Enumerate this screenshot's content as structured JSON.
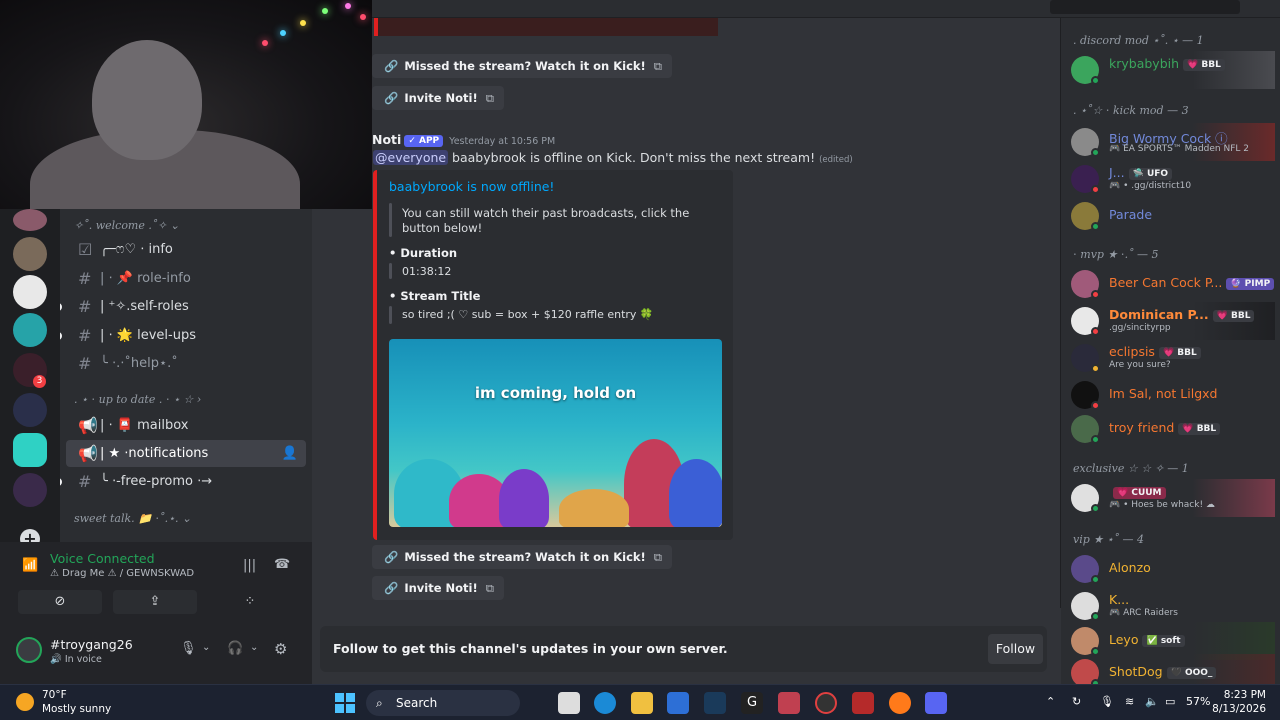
{
  "channels": {
    "categories": {
      "welcome": "✧˚. welcome .˚✧ ⌄",
      "up_to_date": ". ⋆ ⋅ up to date . ⋅ ⋆ ☆ ›",
      "sweet_talk": "sweet talk. 📁 ⋅˚.⋆. ⌄"
    },
    "items": [
      {
        "icon": "☑",
        "label": "╭─ෆ♡ ⋅ info"
      },
      {
        "icon": "#",
        "label": "| ⋅ 📌 role-info"
      },
      {
        "icon": "#",
        "label": "| ⁺✧.self-roles"
      },
      {
        "icon": "#",
        "label": "| ⋅ 🌟 level-ups"
      },
      {
        "icon": "#",
        "label": "╰ ⋅.⋅˚help⋆.˚"
      },
      {
        "icon": "📢",
        "label": "| ⋅ 📮 mailbox"
      },
      {
        "icon": "📢",
        "label": "| ★ ⋅notifications"
      },
      {
        "icon": "#",
        "label": "╰ ⋅-free-promo ⋅→"
      }
    ]
  },
  "voice": {
    "status": "Voice Connected",
    "location": "⚠ Drag Me ⚠ / GEWNSKWAD",
    "username": "#troygang26",
    "user_status": "🔊 In voice"
  },
  "chat": {
    "prev_link1": "Missed the stream? Watch it on Kick!",
    "prev_link2": "Invite Noti!",
    "author": "Noti",
    "app_tag": "✓ APP",
    "timestamp": "Yesterday at 10:56 PM",
    "mention": "@everyone",
    "message": " baabybrook is offline on Kick. Don't miss the next stream!",
    "edited": "(edited)",
    "embed": {
      "title": "baabybrook is now offline!",
      "description": "You can still watch their past broadcasts, click the button below!",
      "field1_name": "• Duration",
      "field1_value": "01:38:12",
      "field2_name": "• Stream Title",
      "field2_value": "so tired ;( ♡ sub = box + $120 raffle entry 🍀",
      "image_caption": "im coming, hold on",
      "accent": "#e02020"
    },
    "link1": "Missed the stream? Watch it on Kick!",
    "link2": "Invite Noti!"
  },
  "follow_bar": {
    "text": "Follow to get this channel's updates in your own server.",
    "button": "Follow"
  },
  "members": {
    "roles": [
      ". discord mod ⋆˚. ⋆ — 1",
      ". ⋆˚☆ ⋅ kick mod — 3",
      "⋅ mvp ★ ⋅.˚ — 5",
      "exclusive ☆ ☆ ✧ — 1",
      "vip ★ ⋆˚ — 4"
    ],
    "list": [
      {
        "name": "krybabybih",
        "tag": "💗 BBL",
        "sub": "",
        "color": "#3ba55d"
      },
      {
        "name": "Big Wormy Cock ⓘ",
        "tag": "",
        "sub": "🎮 EA SPORTS™ Madden NFL 2",
        "color": "#5865f2"
      },
      {
        "name": "J...",
        "tag": "🛸 UFO",
        "sub": "🎮 • .gg/district10",
        "color": "#5865f2"
      },
      {
        "name": "Parade",
        "tag": "",
        "sub": "",
        "color": "#5865f2"
      },
      {
        "name": "Beer Can Cock P...",
        "tag": "🔮 PIMP",
        "sub": "",
        "color": "#f57731"
      },
      {
        "name": "Dominican P...",
        "tag": "💗 BBL",
        "sub": ".gg/sincityrpp",
        "color": "#f57731"
      },
      {
        "name": "eclipsis",
        "tag": "💗 BBL",
        "sub": "Are you sure?",
        "color": "#f57731"
      },
      {
        "name": "Im Sal, not Lilgxd",
        "tag": "",
        "sub": "",
        "color": "#f57731"
      },
      {
        "name": "troy friend",
        "tag": "💗 BBL",
        "sub": "",
        "color": "#f57731"
      },
      {
        "name": "",
        "tag": "💗 CUUM",
        "sub": "🎮 • Hoes be whack! ☁",
        "color": "#ed4245"
      },
      {
        "name": "Alonzo",
        "tag": "",
        "sub": "",
        "color": "#f0b232"
      },
      {
        "name": "K...",
        "tag": "",
        "sub": "🎮 ARC Raiders",
        "color": "#f0b232"
      },
      {
        "name": "Leyo",
        "tag": "✅ soft",
        "sub": "",
        "color": "#f0b232"
      },
      {
        "name": "ShotDog",
        "tag": "🖤 OOO_",
        "sub": "",
        "color": "#f0b232"
      }
    ]
  },
  "taskbar": {
    "temp": "70°F",
    "weather": "Mostly sunny",
    "search": "Search",
    "battery": "57%",
    "time": "8:23 PM",
    "date": "8/13/2026"
  }
}
